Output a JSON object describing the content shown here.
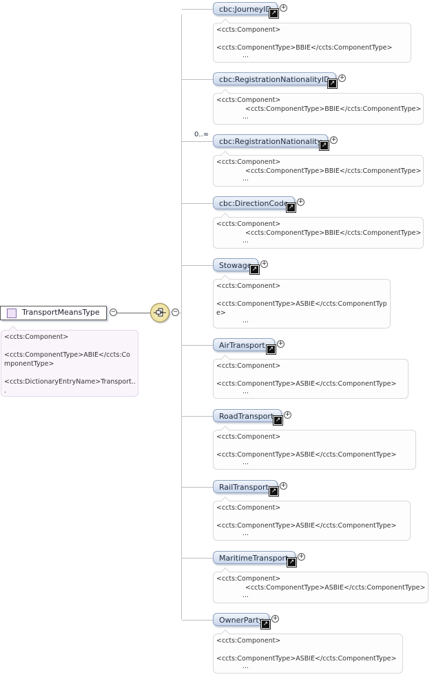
{
  "root": {
    "name": "TransportMeansType",
    "doc": [
      "<ccts:Component>",
      "",
      "<ccts:ComponentType>ABIE</ccts:Co",
      "mponentType>",
      "",
      "<ccts:DictionaryEntryName>Transport..",
      "."
    ]
  },
  "cardinality": "0..∞",
  "elements": [
    {
      "name": "cbc:JourneyID",
      "doc": [
        "<ccts:Component>",
        "",
        "<ccts:ComponentType>BBIE</ccts:ComponentType>"
      ]
    },
    {
      "name": "cbc:RegistrationNationalityID",
      "doc": [
        "<ccts:Component>",
        "<ccts:ComponentType>BBIE</ccts:ComponentType>"
      ]
    },
    {
      "name": "cbc:RegistrationNationality",
      "doc": [
        "<ccts:Component>",
        "<ccts:ComponentType>BBIE</ccts:ComponentType>"
      ]
    },
    {
      "name": "cbc:DirectionCode",
      "doc": [
        "<ccts:Component>",
        "<ccts:ComponentType>BBIE</ccts:ComponentType>"
      ]
    },
    {
      "name": "Stowage",
      "doc": [
        "<ccts:Component>",
        "",
        "<ccts:ComponentType>ASBIE</ccts:ComponentTyp",
        "e>"
      ]
    },
    {
      "name": "AirTransport",
      "doc": [
        "<ccts:Component>",
        "",
        "<ccts:ComponentType>ASBIE</ccts:ComponentType>"
      ]
    },
    {
      "name": "RoadTransport",
      "doc": [
        "<ccts:Component>",
        "",
        "<ccts:ComponentType>ASBIE</ccts:ComponentType>"
      ]
    },
    {
      "name": "RailTransport",
      "doc": [
        "<ccts:Component>",
        "",
        "<ccts:ComponentType>ASBIE</ccts:ComponentType>"
      ]
    },
    {
      "name": "MaritimeTransport",
      "doc": [
        "<ccts:Component>",
        "<ccts:ComponentType>ASBIE</ccts:ComponentType>"
      ]
    },
    {
      "name": "OwnerParty",
      "doc": [
        "<ccts:Component>",
        "",
        "<ccts:ComponentType>ASBIE</ccts:ComponentType>"
      ]
    }
  ],
  "ellipsis": "...",
  "icons": {
    "expand": "plus-circle-icon",
    "reference": "arrow-ref-icon",
    "collapse": "minus-circle-icon",
    "sequence": "sequence-compositor-icon"
  }
}
